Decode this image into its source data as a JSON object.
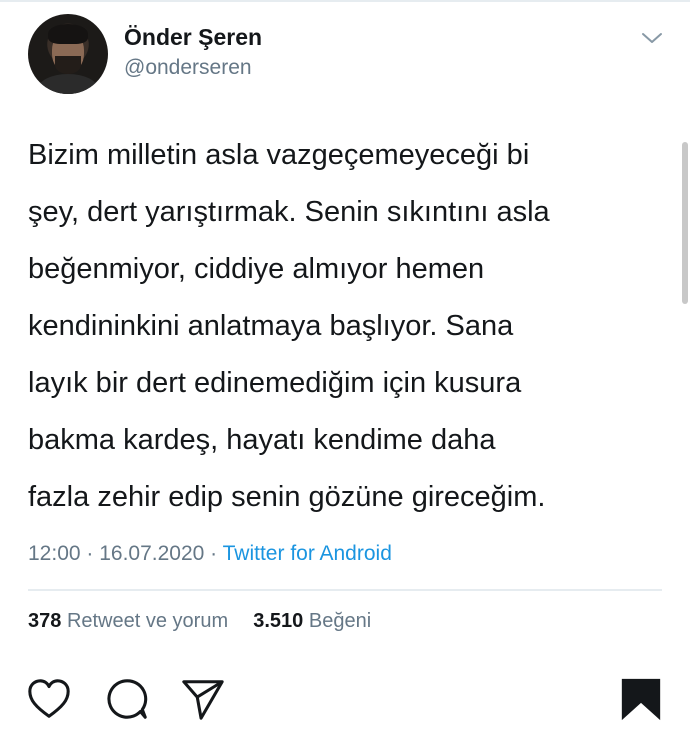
{
  "user": {
    "name": "Önder Şeren",
    "handle": "@onderseren"
  },
  "tweet": {
    "text": "Bizim milletin asla vazgeçemeyeceği bi\nşey, dert yarıştırmak. Senin sıkıntını asla\nbeğenmiyor, ciddiye almıyor hemen\nkendininkini anlatmaya başlıyor. Sana\nlayık bir dert edinemediğim için kusura\nbakma kardeş, hayatı kendime daha\nfazla zehir edip senin gözüne gireceğim.",
    "time": "12:00",
    "date": "16.07.2020",
    "separator": " · ",
    "source": "Twitter for Android"
  },
  "stats": {
    "retweets_count": "378",
    "retweets_label": "Retweet ve yorum",
    "likes_count": "3.510",
    "likes_label": "Beğeni"
  },
  "icons": {
    "chevron": "chevron-down-icon",
    "like": "heart-icon",
    "comment": "comment-icon",
    "share": "send-icon",
    "save": "bookmark-icon"
  },
  "colors": {
    "link": "#1b95e0",
    "muted": "#657786",
    "text": "#14171a"
  }
}
